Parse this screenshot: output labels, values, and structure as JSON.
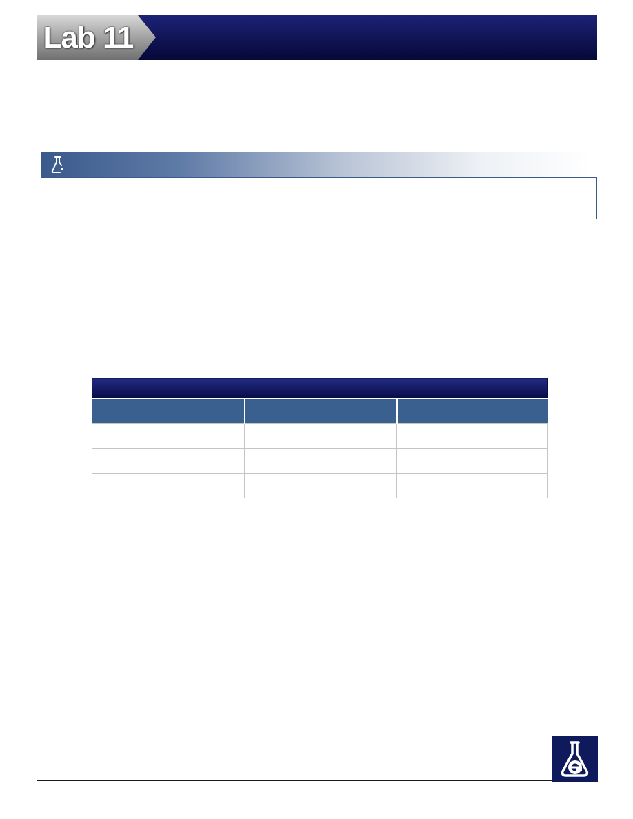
{
  "header": {
    "lab_title": "Lab 11",
    "colors": {
      "bar": "#12165a",
      "tab": "#a2a2a2"
    }
  },
  "callout": {
    "icon": "flask-icon",
    "colors": {
      "header_start": "#3a5a8c",
      "border": "#3a5a8c"
    }
  },
  "table": {
    "title": "",
    "columns": [
      "",
      "",
      ""
    ],
    "rows": [
      [
        "",
        "",
        ""
      ],
      [
        "",
        "",
        ""
      ],
      [
        "",
        "",
        ""
      ]
    ],
    "colors": {
      "title_bar": "#0a0c48",
      "header_row": "#39608f"
    }
  },
  "footer": {
    "logo_icon": "erlenmeyer-flask-e-logo",
    "colors": {
      "logo_bg": "#0f1a5c"
    }
  }
}
